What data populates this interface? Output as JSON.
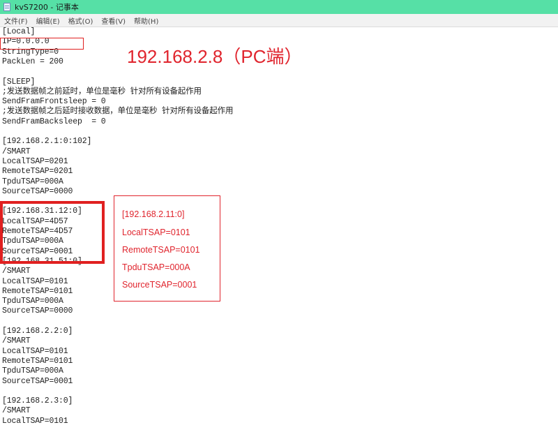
{
  "window": {
    "title": "kvS7200 - 记事本"
  },
  "menu": [
    "文件(F)",
    "编辑(E)",
    "格式(O)",
    "查看(V)",
    "帮助(H)"
  ],
  "editor_lines": [
    "[Local]",
    "IP=0.0.0.0",
    "StringType=0",
    "PackLen = 200",
    "",
    "[SLEEP]",
    ";发送数据帧之前延时，单位是毫秒 针对所有设备起作用",
    "SendFramFrontsleep = 0",
    ";发送数据帧之后延时接收数据，单位是毫秒 针对所有设备起作用",
    "SendFramBacksleep  = 0",
    "",
    "[192.168.2.1:0:102]",
    "/SMART",
    "LocalTSAP=0201",
    "RemoteTSAP=0201",
    "TpduTSAP=000A",
    "SourceTSAP=0000",
    "",
    "[192.168.31.12:0]",
    "LocalTSAP=4D57",
    "RemoteTSAP=4D57",
    "TpduTSAP=000A",
    "SourceTSAP=0001",
    "[192.168.31.51:0]",
    "/SMART",
    "LocalTSAP=0101",
    "RemoteTSAP=0101",
    "TpduTSAP=000A",
    "SourceTSAP=0000",
    "",
    "[192.168.2.2:0]",
    "/SMART",
    "LocalTSAP=0101",
    "RemoteTSAP=0101",
    "TpduTSAP=000A",
    "SourceTSAP=0001",
    "",
    "[192.168.2.3:0]",
    "/SMART",
    "LocalTSAP=0101"
  ],
  "annotation_ip": "192.168.2.8（PC端）",
  "annotation_box": [
    "[192.168.2.11:0]",
    "LocalTSAP=0101",
    "RemoteTSAP=0101",
    "TpduTSAP=000A",
    "SourceTSAP=0001"
  ],
  "colors": {
    "titlebar": "#56e0a6",
    "annotation": "#e0242d"
  }
}
